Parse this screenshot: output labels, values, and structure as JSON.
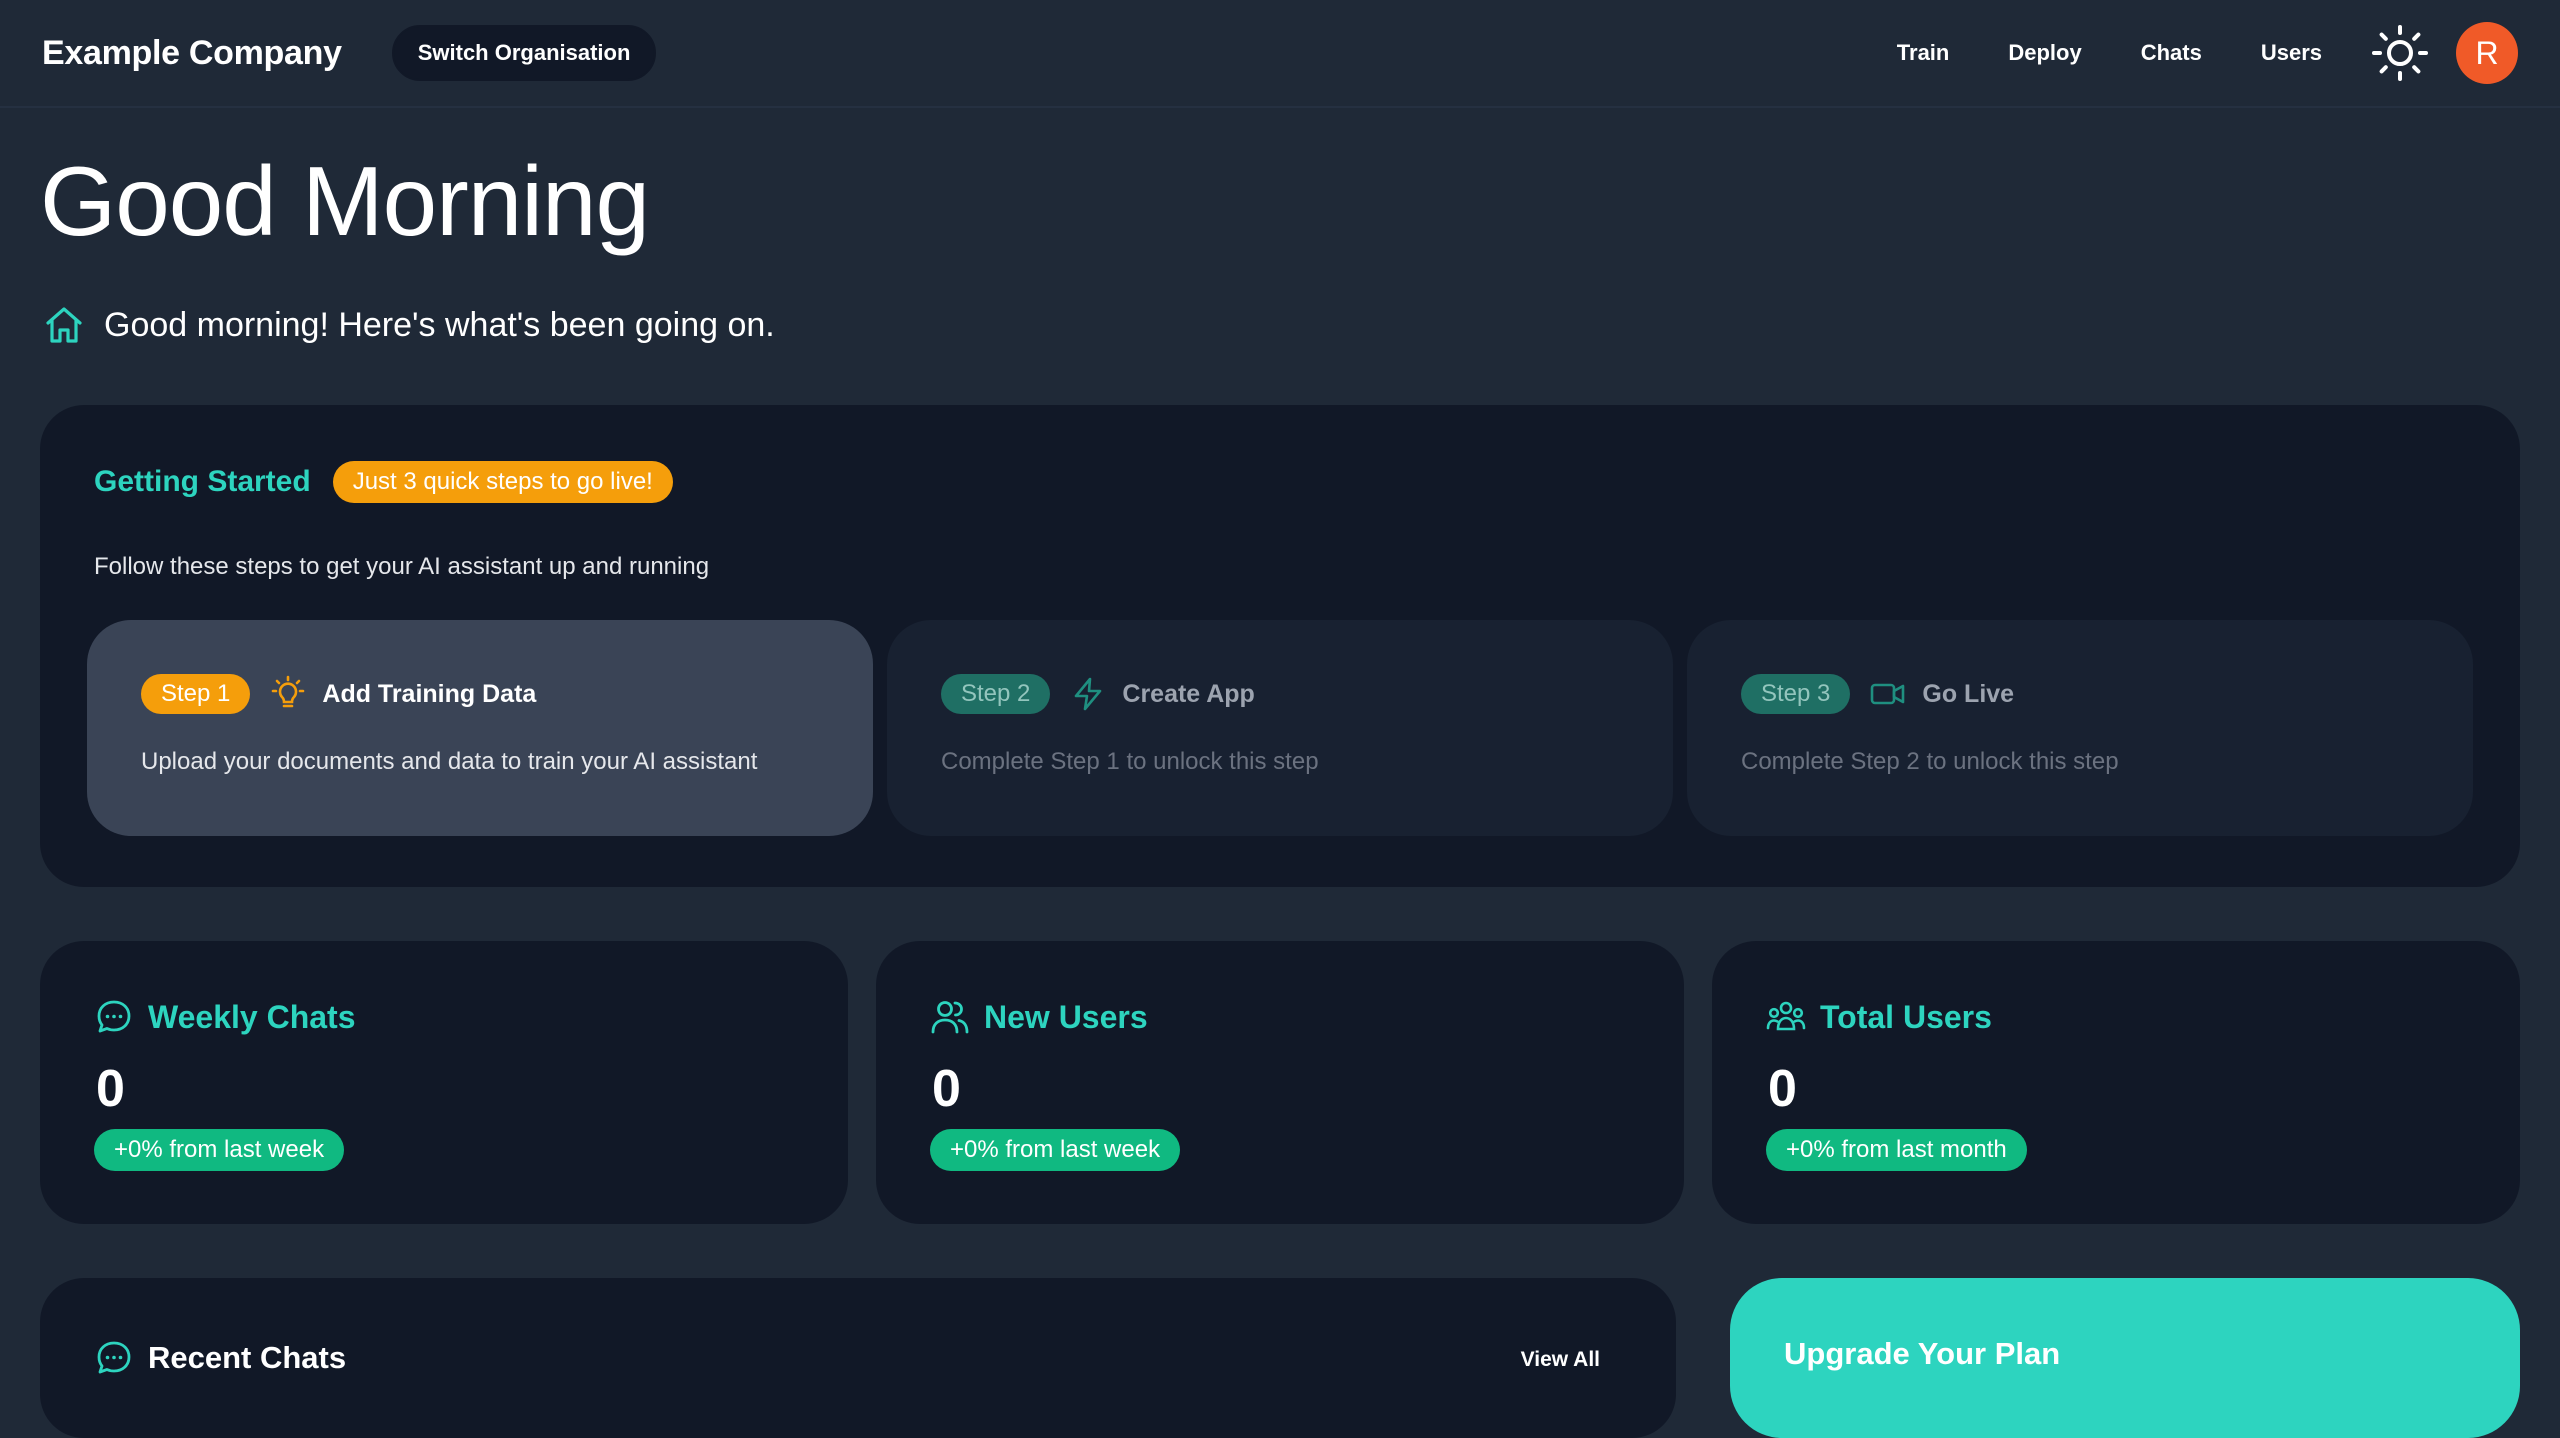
{
  "header": {
    "brand": "Example Company",
    "switch_org_label": "Switch Organisation",
    "nav": [
      "Train",
      "Deploy",
      "Chats",
      "Users"
    ],
    "avatar_initial": "R"
  },
  "greeting": {
    "title": "Good Morning",
    "subtitle": "Good morning! Here's what's been going on."
  },
  "getting_started": {
    "title": "Getting Started",
    "badge": "Just 3 quick steps to go live!",
    "description": "Follow these steps to get your AI assistant up and running",
    "steps": [
      {
        "pill": "Step 1",
        "title": "Add Training Data",
        "description": "Upload your documents and data to train your AI assistant",
        "icon": "lightbulb-icon",
        "state": "active"
      },
      {
        "pill": "Step 2",
        "title": "Create App",
        "description": "Complete Step 1 to unlock this step",
        "icon": "lightning-icon",
        "state": "locked"
      },
      {
        "pill": "Step 3",
        "title": "Go Live",
        "description": "Complete Step 2 to unlock this step",
        "icon": "video-camera-icon",
        "state": "locked"
      }
    ]
  },
  "stats": [
    {
      "title": "Weekly Chats",
      "value": "0",
      "change": "+0% from last week",
      "icon": "chat-bubble-icon"
    },
    {
      "title": "New Users",
      "value": "0",
      "change": "+0% from last week",
      "icon": "users-icon"
    },
    {
      "title": "Total Users",
      "value": "0",
      "change": "+0% from last month",
      "icon": "user-group-icon"
    }
  ],
  "recent_chats": {
    "title": "Recent Chats",
    "view_all_label": "View All"
  },
  "upgrade": {
    "title": "Upgrade Your Plan"
  },
  "colors": {
    "background": "#1f2937",
    "card": "#111827",
    "accent_teal": "#2dd4bf",
    "accent_orange": "#f59e0b",
    "success_green": "#10b981",
    "avatar": "#f05a28"
  }
}
